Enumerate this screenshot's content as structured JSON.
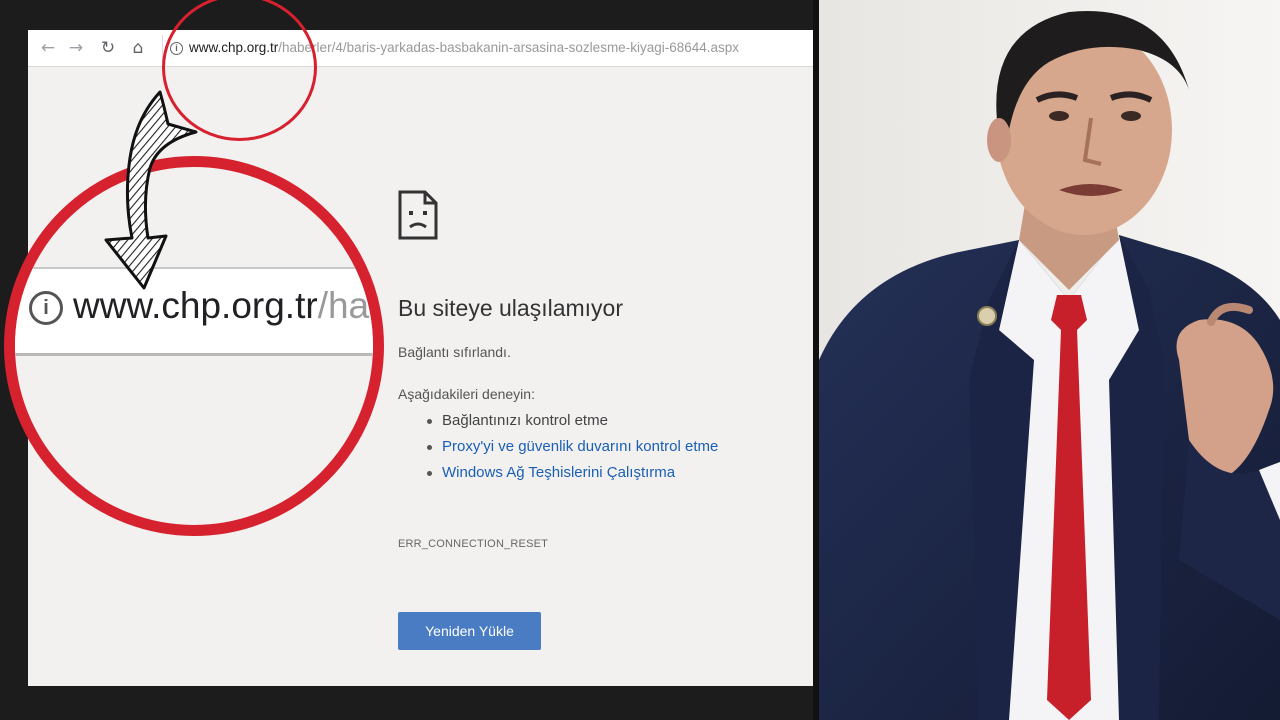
{
  "browser": {
    "nav": {
      "back_glyph": "←",
      "forward_glyph": "→",
      "reload_glyph": "↻",
      "home_glyph": "⌂"
    },
    "omnibox": {
      "url_host": "www.chp.org.tr",
      "url_path": "/haberler/4/baris-yarkadas-basbakanin-arsasina-sozlesme-kiyagi-68644.aspx"
    },
    "error": {
      "title": "Bu siteye ulaşılamıyor",
      "description": "Bağlantı sıfırlandı.",
      "try_label": "Aşağıdakileri deneyin:",
      "suggestions": [
        {
          "text": "Bağlantınızı kontrol etme",
          "link": false
        },
        {
          "text": "Proxy'yi ve güvenlik duvarını kontrol etme",
          "link": true
        },
        {
          "text": "Windows Ağ Teşhislerini Çalıştırma",
          "link": true
        }
      ],
      "code": "ERR_CONNECTION_RESET",
      "reload_label": "Yeniden Yükle"
    }
  },
  "magnifier": {
    "url_host": "www.chp.org.tr",
    "url_path": "/ha"
  },
  "icons": {
    "sad_page": "sad-page-icon",
    "info": "info-icon",
    "arrow": "curved-arrow-icon"
  },
  "colors": {
    "highlight_red": "#d6212e",
    "button_blue": "#4a7cc4",
    "link_blue": "#1a5fb4",
    "page_bg": "#f2f1f0",
    "frame_bg": "#1c1c1c",
    "suit_navy": "#1f2a4a",
    "tie_red": "#c8202b"
  }
}
